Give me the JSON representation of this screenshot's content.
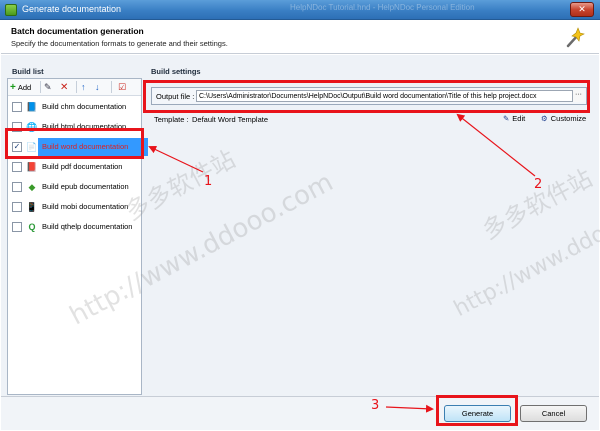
{
  "window": {
    "title": "Generate documentation",
    "background_title_ghost": "HelpNDoc Tutorial.hnd - HelpNDoc Personal Edition",
    "close_glyph": "✕"
  },
  "header": {
    "title": "Batch documentation generation",
    "subtitle": "Specify the documentation formats to generate and their settings."
  },
  "build_list": {
    "section_label": "Build list",
    "toolbar": {
      "add_label": "Add",
      "add_icon": "plus-icon",
      "rename_icon": "rename-icon",
      "delete_icon": "delete-icon",
      "move_up_icon": "arrow-up-icon",
      "move_down_icon": "arrow-down-icon",
      "check_all_icon": "check-all-icon"
    },
    "items": [
      {
        "label": "Build chm documentation",
        "checked": false,
        "icon": "chm-icon",
        "glyph": "📘"
      },
      {
        "label": "Build html documentation",
        "checked": false,
        "icon": "html-icon",
        "glyph": "🌐"
      },
      {
        "label": "Build word documentation",
        "checked": true,
        "icon": "word-icon",
        "glyph": "📄"
      },
      {
        "label": "Build pdf documentation",
        "checked": false,
        "icon": "pdf-icon",
        "glyph": "📕"
      },
      {
        "label": "Build epub documentation",
        "checked": false,
        "icon": "epub-icon",
        "glyph": "◆"
      },
      {
        "label": "Build mobi documentation",
        "checked": false,
        "icon": "mobi-icon",
        "glyph": "📱"
      },
      {
        "label": "Build qthelp documentation",
        "checked": false,
        "icon": "qthelp-icon",
        "glyph": "Q"
      }
    ]
  },
  "build_settings": {
    "section_label": "Build settings",
    "output_file_label": "Output file :",
    "output_file_value": "C:\\Users\\Administrator\\Documents\\HelpNDoc\\Output\\Build word documentation\\Title of this help project.docx",
    "browse_label": "···",
    "template_label": "Template :",
    "template_value": "Default Word Template",
    "edit_label": "Edit",
    "customize_label": "Customize"
  },
  "footer": {
    "generate_label": "Generate",
    "cancel_label": "Cancel"
  },
  "annotations": {
    "labels": [
      "1",
      "2",
      "3"
    ],
    "color": "#e8141b"
  },
  "watermarks": [
    "多多软件站",
    "http://www.ddooo.com",
    "多多软件站",
    "http://www.ddooo.com"
  ],
  "colors": {
    "title_bar": "#3a7fc4",
    "selection": "#3399ff",
    "selected_text": "#e02020",
    "annotation": "#e8141b"
  }
}
